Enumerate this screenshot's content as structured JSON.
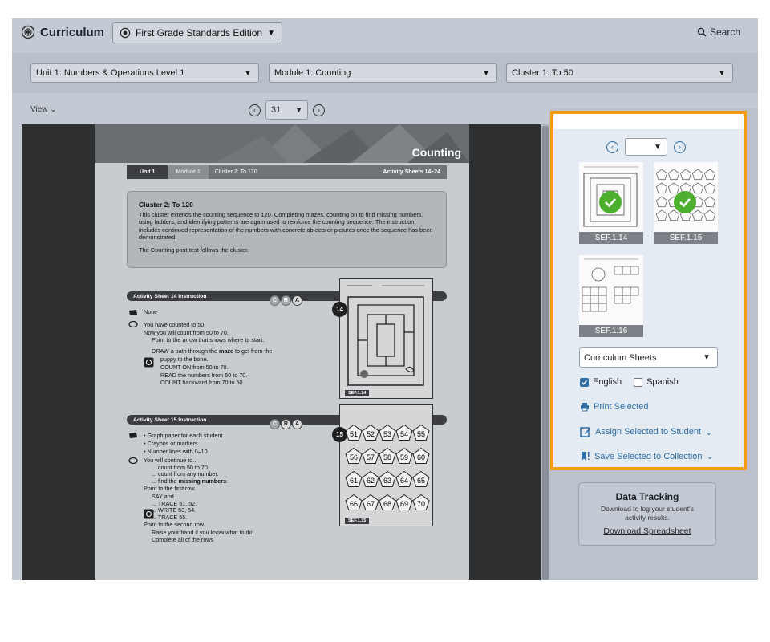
{
  "header": {
    "app_name": "Curriculum",
    "edition": "First Grade Standards Edition",
    "search_label": "Search"
  },
  "filters": {
    "unit": "Unit 1: Numbers & Operations Level 1",
    "module": "Module 1: Counting",
    "cluster": "Cluster 1: To 50"
  },
  "viewer": {
    "view_label": "View",
    "page_number": "31"
  },
  "page": {
    "banner_title": "Counting",
    "crumb_unit": "Unit 1",
    "crumb_module": "Module 1",
    "crumb_cluster": "Cluster 2: To 120",
    "crumb_sheets": "Activity Sheets 14–24",
    "cluster_title": "Cluster 2: To 120",
    "cluster_desc": "This cluster extends the counting sequence to 120. Completing mazes, counting on to find missing numbers, using ladders, and identifying patterns are again used to reinforce the counting sequence. The instruction includes continued representation of the numbers with concrete objects or pictures once the sequence has been demonstrated.",
    "cluster_note": "The Counting post-test follows the cluster.",
    "as14": {
      "heading": "Activity Sheet 14 Instruction",
      "badge": "14",
      "tag": "SEF.1.14",
      "materials": "None",
      "l1": "You have counted to 50.",
      "l2": "Now you will count from 50 to 70.",
      "l3": "Point to the arrow that shows where to start.",
      "l4a": "DRAW a path through the ",
      "l4b": "maze",
      "l4c": " to get from the",
      "l5": "puppy to the bone.",
      "l6": "COUNT ON from 50 to 70.",
      "l7": "READ the numbers from 50 to 70.",
      "l8": "COUNT backward from 70 to 50."
    },
    "as15": {
      "heading": "Activity Sheet 15 Instruction",
      "badge": "15",
      "tag": "SEF.1.15",
      "m1": "Graph paper for each student",
      "m2": "Crayons or markers",
      "m3": "Number lines with 0–10",
      "l1": "You will continue to...",
      "l2": "... count from 50 to 70.",
      "l3": "... count from any number.",
      "l4a": "... find the ",
      "l4b": "missing numbers",
      "l4c": ".",
      "l5": "Point to the first row.",
      "l6": "SAY and ...",
      "l7": "... TRACE 51, 52.",
      "l8": "... WRITE 53, 54.",
      "l9": "... TRACE 55.",
      "l10": "Point to the second row.",
      "l11": "Raise your hand if you know what to do.",
      "l12": "Complete all of the rows",
      "rows": [
        [
          "51",
          "52",
          "53",
          "54",
          "55"
        ],
        [
          "56",
          "57",
          "58",
          "59",
          "60"
        ],
        [
          "61",
          "62",
          "63",
          "64",
          "65"
        ],
        [
          "66",
          "67",
          "68",
          "69",
          "70"
        ]
      ]
    },
    "cra": [
      "C",
      "R",
      "A"
    ]
  },
  "panel": {
    "thumbs": [
      {
        "label": "SEF.1.14",
        "selected": true
      },
      {
        "label": "SEF.1.15",
        "selected": true
      },
      {
        "label": "SEF.1.16",
        "selected": false
      }
    ],
    "sheet_type": "Curriculum Sheets",
    "lang_english": "English",
    "lang_spanish": "Spanish",
    "english_checked": true,
    "spanish_checked": false,
    "print": "Print Selected",
    "assign": "Assign Selected to Student",
    "save": "Save Selected to Collection"
  },
  "data_tracking": {
    "title": "Data Tracking",
    "desc": "Download to log your student's activity results.",
    "link": "Download Spreadsheet"
  },
  "colors": {
    "accent": "#2f6ea5",
    "highlight": "#f39c12",
    "check": "#4caf2e"
  }
}
